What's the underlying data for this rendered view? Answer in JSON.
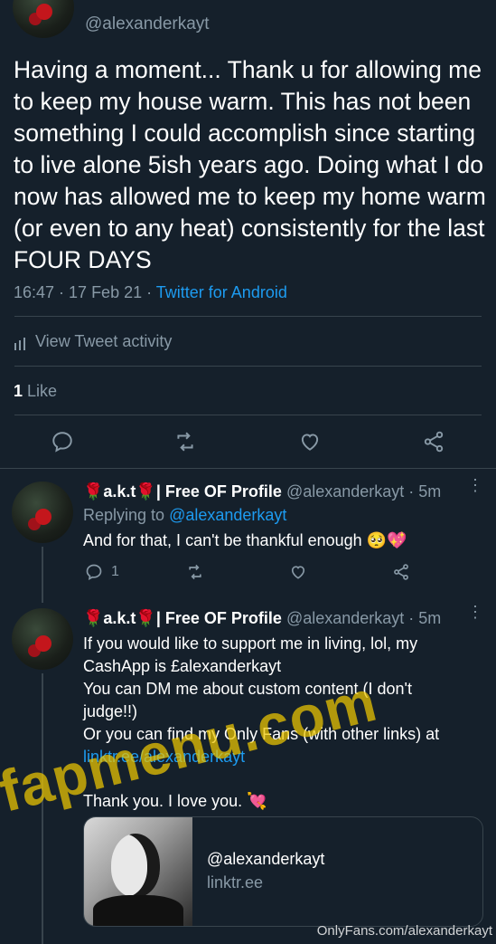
{
  "main_tweet": {
    "handle": "@alexanderkayt",
    "text": "Having a moment... Thank u for allowing me to keep my house warm. This has not been something I could accomplish since starting to live alone 5ish years ago. Doing what I do now has allowed me to keep my home warm (or even to any heat) consistently for the last FOUR DAYS",
    "timestamp": "16:47 · 17 Feb 21 · ",
    "source": "Twitter for Android",
    "activity_label": "View Tweet activity",
    "likes_count": "1",
    "likes_label": " Like"
  },
  "reply1": {
    "name": "🌹a.k.t🌹| Free OF Profile",
    "handle_time": "@alexanderkayt · 5m",
    "replying_prefix": "Replying to ",
    "replying_handle": "@alexanderkayt",
    "text": "And for that, I can't be thankful enough 🥺💖",
    "reply_count": "1"
  },
  "reply2": {
    "name": "🌹a.k.t🌹| Free OF Profile",
    "handle_time": "@alexanderkayt · 5m",
    "line1": "If you would like to support me in living, lol, my",
    "line2": "CashApp is £alexanderkayt",
    "line3": "You can DM me about custom content (I don't",
    "line4": "judge!!)",
    "line5": "Or you can find my Only Fans (with other links) at",
    "link": "linktr.ee/alexanderkayt",
    "line6": "Thank you. I love you. 💘",
    "card_title": "@alexanderkayt",
    "card_domain": "linktr.ee"
  },
  "watermark": {
    "site": "fapmenu.com",
    "onlyfans": "OnlyFans.com/alexanderkayt"
  },
  "colors": {
    "background": "#15202b",
    "accent": "#1d9bf0",
    "muted": "#8899a6",
    "divider": "#38444d"
  }
}
